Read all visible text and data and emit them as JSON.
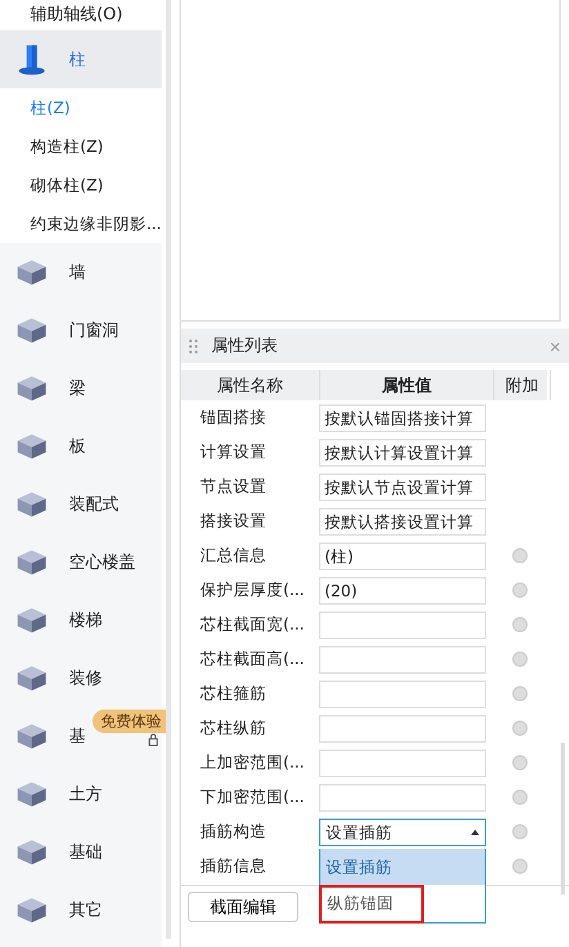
{
  "sidebar": {
    "top_item": "辅助轴线(O)",
    "categories": [
      {
        "label": "柱",
        "selected": true,
        "expanded": true,
        "children": [
          {
            "label": "柱(Z)",
            "selected": true
          },
          {
            "label": "构造柱(Z)",
            "selected": false
          },
          {
            "label": "砌体柱(Z)",
            "selected": false
          },
          {
            "label": "约束边缘非阴影...",
            "selected": false
          }
        ]
      },
      {
        "label": "墙",
        "selected": false
      },
      {
        "label": "门窗洞",
        "selected": false
      },
      {
        "label": "梁",
        "selected": false
      },
      {
        "label": "板",
        "selected": false
      },
      {
        "label": "装配式",
        "selected": false
      },
      {
        "label": "空心楼盖",
        "selected": false
      },
      {
        "label": "楼梯",
        "selected": false
      },
      {
        "label": "装修",
        "selected": false
      },
      {
        "label": "基",
        "selected": false,
        "badge": "免费体验",
        "locked": true
      },
      {
        "label": "土方",
        "selected": false
      },
      {
        "label": "基础",
        "selected": false
      },
      {
        "label": "其它",
        "selected": false
      }
    ]
  },
  "properties": {
    "title": "属性列表",
    "close": "×",
    "columns": [
      "属性名称",
      "属性值",
      "附加"
    ],
    "rows": [
      {
        "name": "锚固搭接",
        "kind": "text",
        "value": "按默认锚固搭接计算",
        "extra": false
      },
      {
        "name": "计算设置",
        "kind": "text",
        "value": "按默认计算设置计算",
        "extra": false
      },
      {
        "name": "节点设置",
        "kind": "text",
        "value": "按默认节点设置计算",
        "extra": false
      },
      {
        "name": "搭接设置",
        "kind": "text",
        "value": "按默认搭接设置计算",
        "extra": false
      },
      {
        "name": "汇总信息",
        "kind": "text",
        "value": "(柱)",
        "extra": true
      },
      {
        "name": "保护层厚度(...",
        "kind": "text",
        "value": "(20)",
        "extra": true
      },
      {
        "name": "芯柱截面宽(...",
        "kind": "text",
        "extra": true
      },
      {
        "name": "芯柱截面高(...",
        "kind": "text",
        "extra": true
      },
      {
        "name": "芯柱箍筋",
        "kind": "text",
        "extra": true
      },
      {
        "name": "芯柱纵筋",
        "kind": "text",
        "extra": true
      },
      {
        "name": "上加密范围(...",
        "kind": "text",
        "extra": true
      },
      {
        "name": "下加密范围(...",
        "kind": "text",
        "extra": true
      },
      {
        "name": "插筋构造",
        "kind": "select",
        "value": "设置插筋",
        "extra": true,
        "expanded": true,
        "options": [
          {
            "label": "设置插筋",
            "selected": true,
            "marked": false
          },
          {
            "label": "纵筋锚固",
            "selected": false,
            "marked": true
          }
        ]
      },
      {
        "name": "插筋信息",
        "kind": "covered",
        "extra": true
      }
    ],
    "button": "截面编辑"
  }
}
